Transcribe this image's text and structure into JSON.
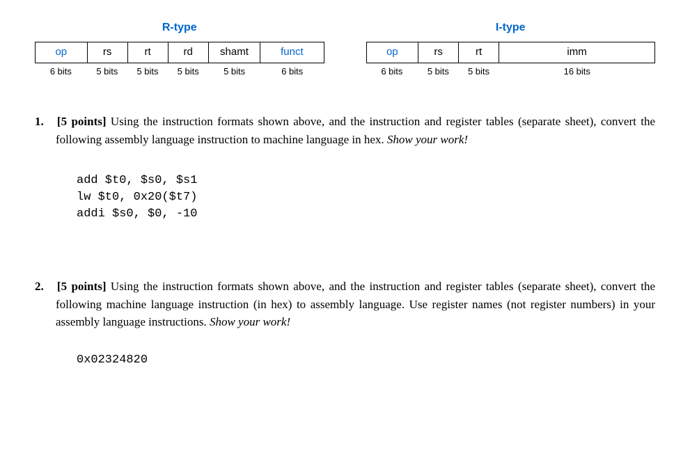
{
  "formats": {
    "rtype": {
      "title": "R-type",
      "fields": [
        {
          "label": "op",
          "bits": "6 bits",
          "class": "r-op",
          "colored": true
        },
        {
          "label": "rs",
          "bits": "5 bits",
          "class": "r-rs",
          "colored": false
        },
        {
          "label": "rt",
          "bits": "5 bits",
          "class": "r-rt",
          "colored": false
        },
        {
          "label": "rd",
          "bits": "5 bits",
          "class": "r-rd",
          "colored": false
        },
        {
          "label": "shamt",
          "bits": "5 bits",
          "class": "r-shamt",
          "colored": false
        },
        {
          "label": "funct",
          "bits": "6 bits",
          "class": "r-funct",
          "colored": true
        }
      ]
    },
    "itype": {
      "title": "I-type",
      "fields": [
        {
          "label": "op",
          "bits": "6 bits",
          "class": "i-op",
          "colored": true
        },
        {
          "label": "rs",
          "bits": "5 bits",
          "class": "i-rs",
          "colored": false
        },
        {
          "label": "rt",
          "bits": "5 bits",
          "class": "i-rt",
          "colored": false
        },
        {
          "label": "imm",
          "bits": "16 bits",
          "class": "i-imm",
          "colored": false
        }
      ]
    }
  },
  "q1": {
    "num": "1.",
    "points": "[5 points]",
    "body_a": " Using the instruction formats shown above, and the instruction and register tables (separate sheet), convert the following assembly language instruction to machine language in hex.  ",
    "show_work": "Show your work!",
    "code": [
      "add $t0, $s0, $s1",
      "lw $t0, 0x20($t7)",
      "addi $s0, $0, -10"
    ]
  },
  "q2": {
    "num": "2.",
    "points": "[5 points]",
    "body_a": " Using the instruction formats shown above, and the instruction and register tables (separate sheet), convert the following machine language instruction (in hex) to assembly language.  Use register names (not register numbers) in your assembly language instructions.  ",
    "show_work": "Show your work!",
    "code": [
      "0x02324820"
    ]
  }
}
